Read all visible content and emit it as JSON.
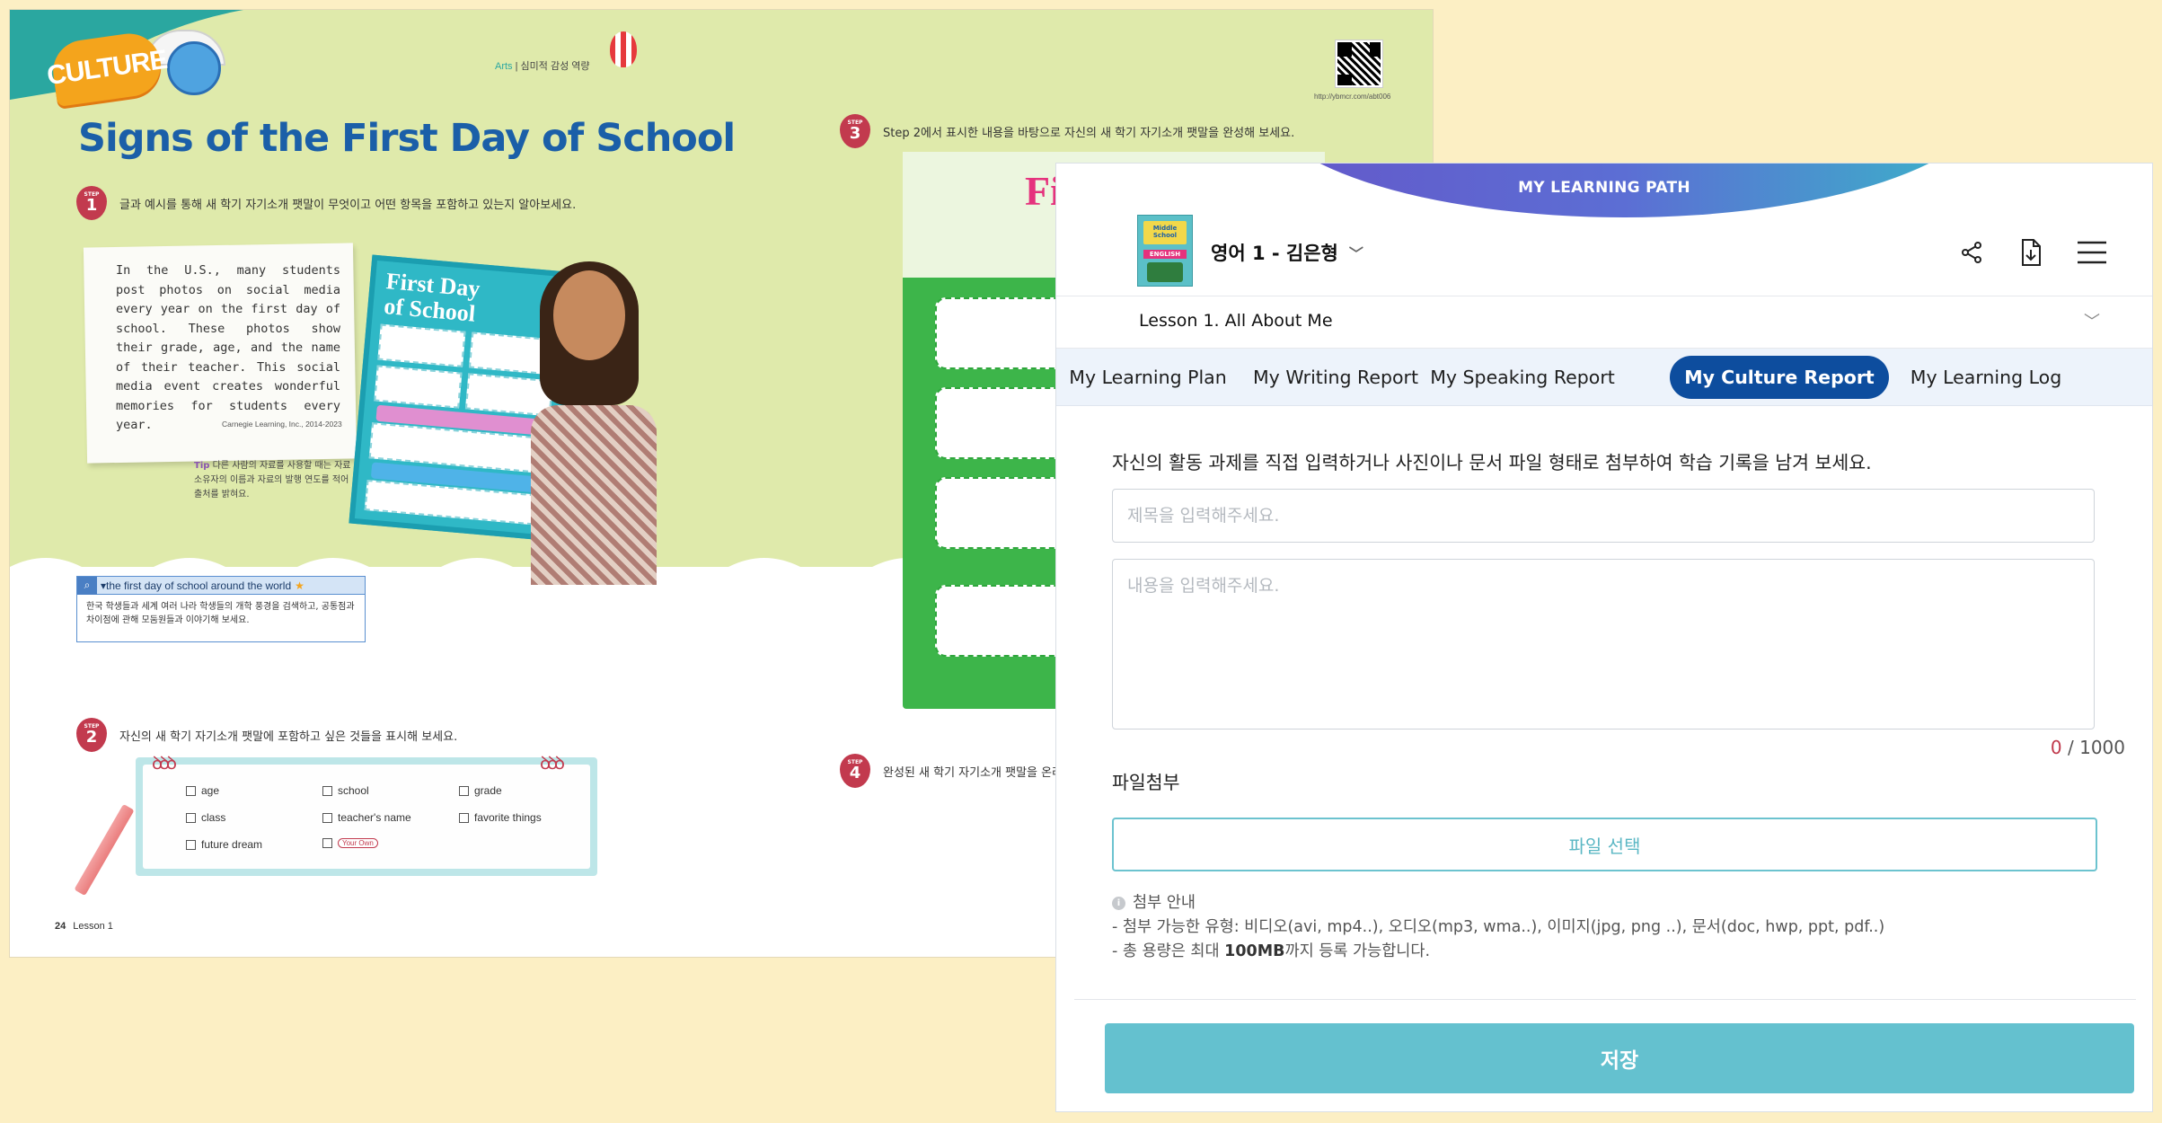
{
  "textbook": {
    "badge": "CULTURE",
    "arts_tag_en": "Arts",
    "arts_tag_ko": "심미적 감성 역량",
    "qr_url": "http://ybmcr.com/abt006",
    "title": "Signs of the First Day of School",
    "step_label": "STEP",
    "step1": {
      "num": "1",
      "text": "글과 예시를 통해 새 학기 자기소개 팻말이 무엇이고 어떤 항목을 포함하고 있는지 알아보세요."
    },
    "note_text": "In the U.S., many students post photos on social media every year on the first day of school. These photos show their grade, age, and the name of their teacher. This social media event creates wonderful memories for students every year.",
    "note_source": "Carnegie Learning, Inc., 2014-2023",
    "tip_tag": "Tip",
    "tip_text": "다른 사람의 자료를 사용할 때는 자료 소유자의 이름과 자료의 발행 연도를 적어 출처를 밝혀요.",
    "poster_title_1": "First Day",
    "poster_title_2": "of School",
    "search_query": "the first day of school around the world",
    "search_desc": "한국 학생들과 세계 여러 나라 학생들의 개학 풍경을 검색하고, 공통점과 차이점에 관해 모둠원들과 이야기해 보세요.",
    "step2": {
      "num": "2",
      "text": "자신의 새 학기 자기소개 팻말에 포함하고 싶은 것들을 표시해 보세요."
    },
    "checklist": [
      "age",
      "school",
      "grade",
      "class",
      "teacher's name",
      "favorite things",
      "future dream"
    ],
    "your_own": "Your Own",
    "step3": {
      "num": "3",
      "text": "Step 2에서 표시한 내용을 바탕으로 자신의 새 학기 자기소개 팻말을 완성해 보세요."
    },
    "step4": {
      "num": "4",
      "text": "완성된 새 학기 자기소개 팻말을 온라"
    },
    "page_number": "24",
    "page_lesson": "Lesson 1",
    "frame_title": "Fi"
  },
  "app": {
    "header_label": "MY LEARNING PATH",
    "book_cover": {
      "line1": "Middle School",
      "line2": "ENGLISH"
    },
    "course_title": "영어 1 - 김은형",
    "icons": {
      "share": "share-icon",
      "download": "download-icon",
      "menu": "hamburger-menu-icon"
    },
    "lesson": "Lesson 1. All About Me",
    "tabs": [
      {
        "label": "My Learning Plan"
      },
      {
        "label": "My Writing Report"
      },
      {
        "label": "My Speaking Report"
      },
      {
        "label": "My Culture Report"
      },
      {
        "label": "My Learning Log"
      }
    ],
    "active_tab": "My Culture Report",
    "instruction": "자신의 활동 과제를 직접 입력하거나 사진이나 문서 파일 형태로 첨부하여 학습 기록을 남겨 보세요.",
    "title_placeholder": "제목을 입력해주세요.",
    "title_value": "",
    "content_placeholder": "내용을 입력해주세요.",
    "content_value": "",
    "char_count": {
      "current": "0",
      "max": "/ 1000"
    },
    "attach_label": "파일첨부",
    "file_button": "파일 선택",
    "guide": {
      "title": "첨부 안내",
      "line1": "- 첨부 가능한 유형: 비디오(avi, mp4..), 오디오(mp3, wma..), 이미지(jpg, png ..), 문서(doc, hwp, ppt, pdf..)",
      "line2_pre": "- 총 용량은 최대 ",
      "line2_bold": "100MB",
      "line2_post": "까지 등록 가능합니다."
    },
    "save_button": "저장",
    "colors": {
      "accent": "#0d4d9e",
      "save": "#64c1cf",
      "count": "#c0394b"
    }
  }
}
